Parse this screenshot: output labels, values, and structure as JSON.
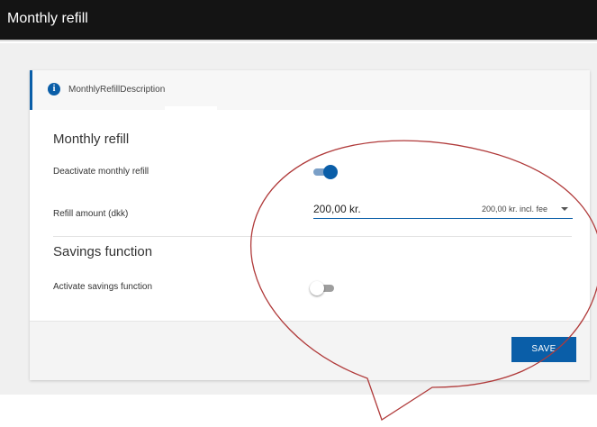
{
  "header": {
    "title": "Monthly refill"
  },
  "banner": {
    "text": "MonthlyRefillDescription",
    "icon": "info-icon"
  },
  "monthly_refill": {
    "section_title": "Monthly refill",
    "deactivate_label": "Deactivate monthly refill",
    "deactivate_on": true,
    "amount_label": "Refill amount (dkk)",
    "amount_value": "200,00 kr.",
    "amount_fee": "200,00 kr. incl. fee"
  },
  "savings": {
    "section_title": "Savings function",
    "activate_label": "Activate savings function",
    "activate_on": false
  },
  "footer": {
    "save_label": "SAVE"
  },
  "colors": {
    "accent": "#0a5ea8",
    "header_bg": "#141414",
    "annotation": "#b03a3a"
  }
}
